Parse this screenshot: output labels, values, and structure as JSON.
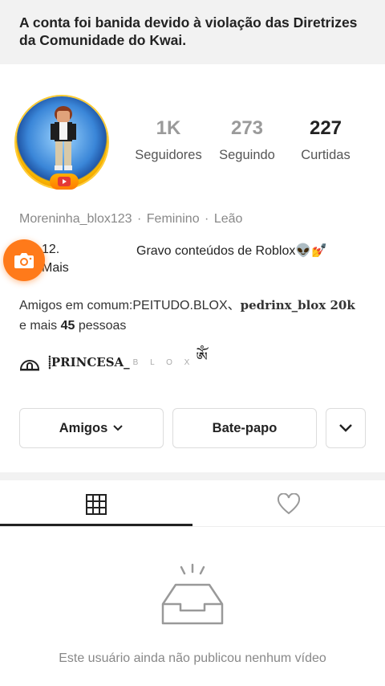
{
  "banner": {
    "text": "A conta foi banida devido à violação das Diretrizes da Comunidade do Kwai."
  },
  "profile": {
    "stats": [
      {
        "value": "1K",
        "label": "Seguidores"
      },
      {
        "value": "273",
        "label": "Seguindo"
      },
      {
        "value": "227",
        "label": "Curtidas"
      }
    ],
    "username": "Moreninha_blox123",
    "gender": "Feminino",
    "sign": "Leão",
    "separator": "·",
    "bio_left": "12.",
    "bio_right": "Gravo conteúdos de Roblox👽💅",
    "bio_more": "Mais",
    "mutual_prefix": "Amigos em comum:",
    "mutual_friend_1": "PEITUDO.BLOX、",
    "mutual_friend_2": "pedrinx_blox 20k",
    "mutual_more_prefix": "e mais ",
    "mutual_count": "45",
    "mutual_suffix": " pessoas",
    "linked_name": "⸽PRINCESA_",
    "linked_light": "B L O X"
  },
  "actions": {
    "friends_label": "Amigos",
    "chat_label": "Bate-papo"
  },
  "tabs": [
    {
      "icon": "grid-icon",
      "active": true
    },
    {
      "icon": "heart-icon",
      "active": false
    }
  ],
  "empty_state": {
    "text": "Este usuário ainda não publicou nenhum vídeo"
  },
  "colors": {
    "accent": "#ff7a1a",
    "muted": "#888888",
    "divider": "#f2f2f2"
  }
}
